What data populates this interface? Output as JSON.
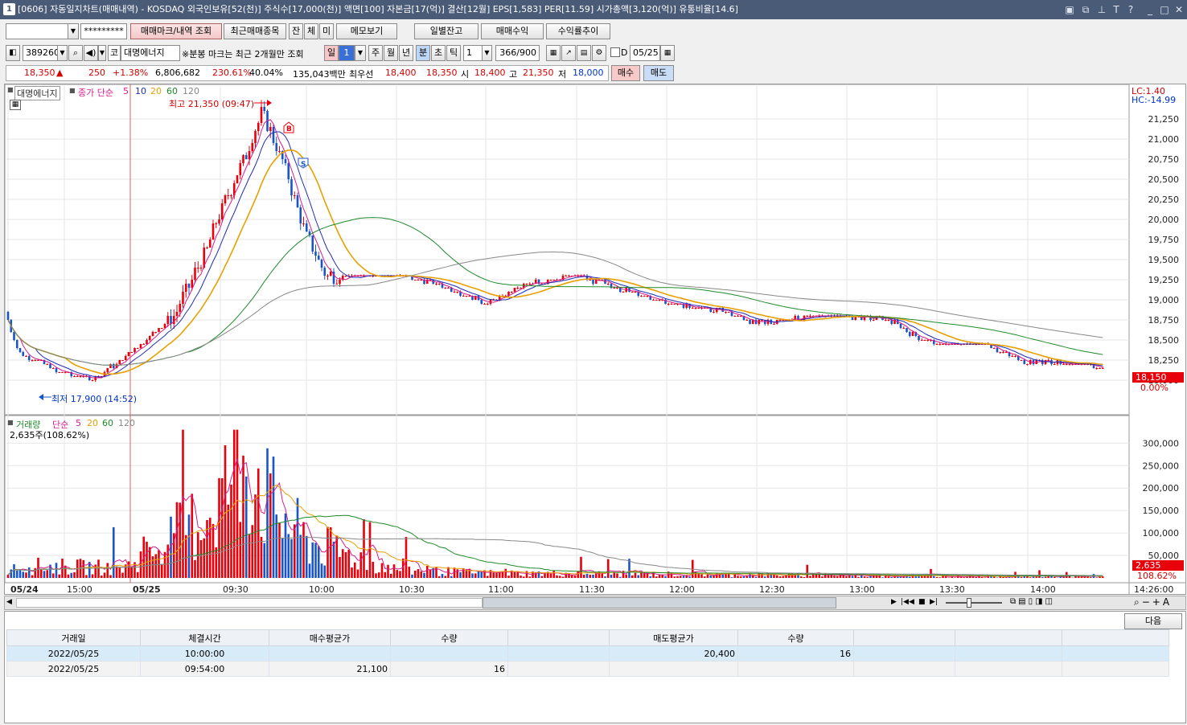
{
  "window": {
    "number": "1",
    "title": "[0606] 자동일지차트(매매내역) - KOSDAQ 외국인보유[52(천)] 주식수[17,000(천)] 액면[100] 자본금[17(억)] 결산[12월] EPS[1,583] PER[11.59] 시가총액[3,120(억)] 유통비율[14.6]",
    "icons": [
      "layout-icon",
      "copy-icon",
      "pin-icon",
      "font-icon",
      "help-icon",
      "minimize-icon",
      "maximize-icon",
      "close-icon"
    ]
  },
  "toolbar1": {
    "account_value": "",
    "password_mask": "*********",
    "btn_trade_mark": "매매마크/내역 조회",
    "btn_recent": "최근매매종목",
    "btn_jan": "잔",
    "btn_che": "체",
    "btn_mi": "미",
    "btn_memo": "메모보기",
    "btn_daily_balance": "일별잔고",
    "btn_trade_profit": "매매수익",
    "btn_return_trend": "수익률추이"
  },
  "toolbar2": {
    "code": "389260",
    "market_badge": "코",
    "stock_name": "대명에너지",
    "notice": "※분봉 마크는 최근 2개월만 조회",
    "periods": [
      "일",
      "1",
      "주",
      "월",
      "년",
      "분",
      "초",
      "틱"
    ],
    "active_period": "분",
    "interval": "1",
    "count": "366/900",
    "checkbox_label": "D",
    "date": "05/25"
  },
  "pricebar": {
    "price": "18,350",
    "change_arrow": "▲",
    "change": "250",
    "change_pct": "+1.38%",
    "volume": "6,806,682",
    "vol_ratio": "230.61%",
    "turnover": "40.04%",
    "amount": "135,043백만",
    "best_label": "최우선",
    "bid1": "18,400",
    "ask1": "18,350",
    "open_label": "시",
    "open": "18,400",
    "high_label": "고",
    "high": "21,350",
    "low_label": "저",
    "low": "18,000",
    "buy_btn": "매수",
    "sell_btn": "매도"
  },
  "price_panel": {
    "stock_tag": "대명에너지",
    "legend": [
      "종가 단순",
      "5",
      "10",
      "20",
      "60",
      "120"
    ],
    "high_marker": "최고 21,350 (09:47)",
    "low_marker": "최저 17,900 (14:52)",
    "lc": "LC:1.40",
    "hc": "HC:-14.99",
    "current_tag": "18,150",
    "current_pct": "0.00%",
    "buy_mark": "B",
    "sell_mark": "S",
    "y_ticks": [
      "21,250",
      "21,000",
      "20,750",
      "20,500",
      "20,250",
      "20,000",
      "19,750",
      "19,500",
      "19,250",
      "19,000",
      "18,750",
      "18,500",
      "18,250",
      "18,000"
    ]
  },
  "volume_panel": {
    "legend": [
      "거래량",
      "단순",
      "5",
      "20",
      "60",
      "120"
    ],
    "info": "2,635주(108.62%)",
    "y_ticks": [
      "300,000",
      "250,000",
      "200,000",
      "150,000",
      "100,000",
      "50,000"
    ],
    "current_tag": "2,635",
    "current_pct": "108.62%"
  },
  "x_axis": {
    "labels": [
      "05/24",
      "15:00",
      "05/25",
      "09:30",
      "10:00",
      "10:30",
      "11:00",
      "11:30",
      "12:00",
      "12:30",
      "13:00",
      "13:30",
      "14:00"
    ],
    "end_label": "14:26:00"
  },
  "colors": {
    "up": "#e8000b",
    "down": "#1a55c8",
    "ma5": "#d81b8a",
    "ma10": "#1f2fb5",
    "ma20": "#e8a000",
    "ma60": "#1f8a2a",
    "ma120": "#888888"
  },
  "grid": {
    "next_button": "다음",
    "headers": [
      "거래일",
      "체결시간",
      "매수평균가",
      "수량",
      "",
      "매도평균가",
      "수량",
      "",
      "",
      ""
    ],
    "rows": [
      [
        "2022/05/25",
        "10:00:00",
        "",
        "",
        "",
        "20,400",
        "16",
        "",
        "",
        ""
      ],
      [
        "2022/05/25",
        "09:54:00",
        "21,100",
        "16",
        "",
        "",
        "",
        "",
        "",
        ""
      ]
    ]
  },
  "chart_data": {
    "type": "candlestick",
    "symbol": "389260",
    "name": "대명에너지",
    "interval": "1분",
    "high": 21350,
    "high_time": "09:47",
    "low": 17900,
    "low_time": "14:52",
    "last": 18150,
    "price_anchors": [
      [
        "05/24 14:40",
        18850
      ],
      [
        "05/24 14:50",
        18350
      ],
      [
        "05/24 15:00",
        18250
      ],
      [
        "05/24 15:20",
        18120
      ],
      [
        "05/25 09:00",
        18300
      ],
      [
        "05/25 09:10",
        18800
      ],
      [
        "05/25 09:20",
        19600
      ],
      [
        "05/25 09:30",
        20100
      ],
      [
        "05/25 09:40",
        20800
      ],
      [
        "05/25 09:47",
        21350
      ],
      [
        "05/25 09:55",
        20600
      ],
      [
        "05/25 10:00",
        19800
      ],
      [
        "05/25 10:10",
        19300
      ],
      [
        "05/25 10:30",
        19300
      ],
      [
        "05/25 10:50",
        19200
      ],
      [
        "05/25 11:00",
        18950
      ],
      [
        "05/25 11:20",
        19200
      ],
      [
        "05/25 11:40",
        19300
      ],
      [
        "05/25 12:00",
        18950
      ],
      [
        "05/25 12:30",
        18700
      ],
      [
        "05/25 13:00",
        18800
      ],
      [
        "05/25 13:20",
        18750
      ],
      [
        "05/25 13:30",
        18500
      ],
      [
        "05/25 13:50",
        18450
      ],
      [
        "05/25 14:00",
        18250
      ],
      [
        "05/25 14:26",
        18150
      ]
    ],
    "volume_anchors": [
      [
        "05/24 14:40",
        30000
      ],
      [
        "05/25 09:00",
        25000
      ],
      [
        "05/25 09:20",
        140000
      ],
      [
        "05/25 09:30",
        200000
      ],
      [
        "05/25 09:35",
        320000
      ],
      [
        "05/25 09:45",
        180000
      ],
      [
        "05/25 10:00",
        90000
      ],
      [
        "05/25 10:30",
        20000
      ],
      [
        "05/25 11:00",
        12000
      ],
      [
        "05/25 14:26",
        2635
      ]
    ]
  }
}
